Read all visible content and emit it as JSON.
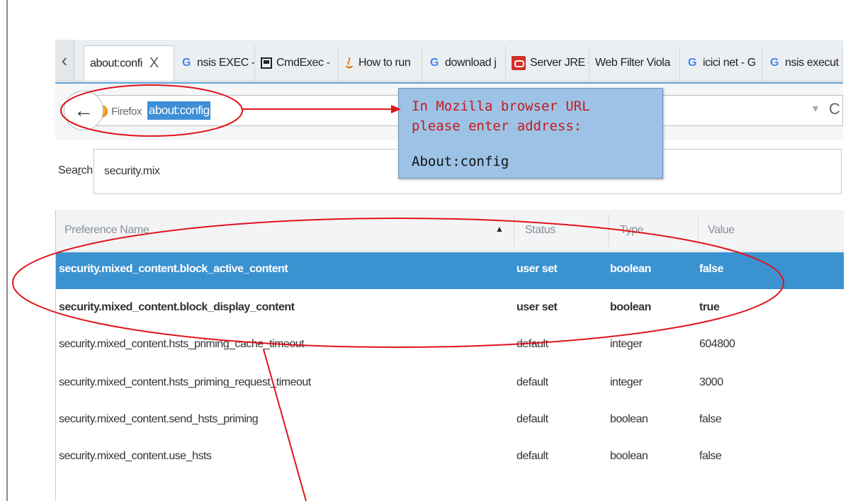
{
  "tabs": [
    {
      "label": "about:confi",
      "icon": "document-icon",
      "active": true,
      "close": "X"
    },
    {
      "label": "nsis EXEC -",
      "icon": "google-icon"
    },
    {
      "label": "CmdExec -",
      "icon": "terminal-icon"
    },
    {
      "label": "How to run",
      "icon": "java-icon"
    },
    {
      "label": "download j",
      "icon": "google-icon"
    },
    {
      "label": "Server JRE (",
      "icon": "oracle-icon"
    },
    {
      "label": "Web Filter Viola",
      "icon": ""
    },
    {
      "label": "icici net - G",
      "icon": "google-icon"
    },
    {
      "label": "nsis execut",
      "icon": "google-icon"
    }
  ],
  "tab_scroll": "‹",
  "urlbar": {
    "identity": "Firefox",
    "url": "about:config",
    "dropdown": "▼",
    "reload": "C"
  },
  "search": {
    "label_pre": "Sea",
    "label_u": "r",
    "label_post": "ch:",
    "value": "security.mix"
  },
  "table": {
    "columns": {
      "name": "Preference Name",
      "status": "Status",
      "type": "Type",
      "value": "Value"
    },
    "sort_arrow": "▲",
    "rows": [
      {
        "name": "security.mixed_content.block_active_content",
        "status": "user set",
        "type": "boolean",
        "value": "false"
      },
      {
        "name": "security.mixed_content.block_display_content",
        "status": "user set",
        "type": "boolean",
        "value": "true"
      },
      {
        "name": "security.mixed_content.hsts_priming_cache_timeout",
        "status": "default",
        "type": "integer",
        "value": "604800"
      },
      {
        "name": "security.mixed_content.hsts_priming_request_timeout",
        "status": "default",
        "type": "integer",
        "value": "3000"
      },
      {
        "name": "security.mixed_content.send_hsts_priming",
        "status": "default",
        "type": "boolean",
        "value": "false"
      },
      {
        "name": "security.mixed_content.use_hsts",
        "status": "default",
        "type": "boolean",
        "value": "false"
      }
    ]
  },
  "callout": {
    "line1": "In Mozilla browser URL",
    "line2": "please enter address:",
    "line3": "About:config"
  },
  "colors": {
    "selection": "#3b92d1",
    "annotation": "#e0141b",
    "callout_bg": "#9cc3e6"
  }
}
